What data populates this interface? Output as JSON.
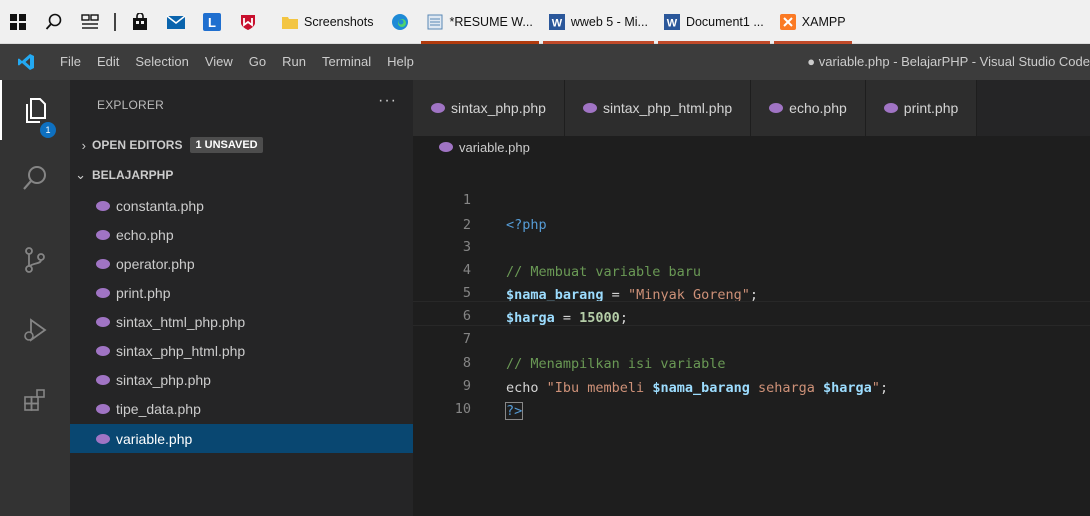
{
  "taskbar": {
    "windows": [
      {
        "label": "Screenshots"
      },
      {
        "label": "*RESUME W..."
      },
      {
        "label": "wweb 5 - Mi..."
      },
      {
        "label": "Document1 ..."
      },
      {
        "label": "XAMPP"
      }
    ]
  },
  "menubar": {
    "items": [
      "File",
      "Edit",
      "Selection",
      "View",
      "Go",
      "Run",
      "Terminal",
      "Help"
    ],
    "window_title": "● variable.php - BelajarPHP - Visual Studio Code"
  },
  "activity": {
    "explorer_badge": "1"
  },
  "sidebar": {
    "header": "EXPLORER",
    "more": "···",
    "open_editors": {
      "label": "OPEN EDITORS",
      "badge": "1 UNSAVED"
    },
    "folder": "BELAJARPHP",
    "files": [
      "constanta.php",
      "echo.php",
      "operator.php",
      "print.php",
      "sintax_html_php.php",
      "sintax_php_html.php",
      "sintax_php.php",
      "tipe_data.php",
      "variable.php"
    ],
    "selected_file": "variable.php"
  },
  "tabs": [
    "sintax_php.php",
    "sintax_php_html.php",
    "echo.php",
    "print.php"
  ],
  "breadcrumb": "variable.php",
  "editor": {
    "line_numbers": [
      "1",
      "2",
      "3",
      "4",
      "5",
      "6",
      "7",
      "8",
      "9",
      "10"
    ],
    "lines": {
      "l1_tag": "<?php",
      "l3_comment": "// Membuat variable baru",
      "l4_var": "$nama_barang",
      "l4_op": " = ",
      "l4_str": "\"Minyak Goreng\"",
      "l4_end": ";",
      "l5_var": "$harga",
      "l5_op": " = ",
      "l5_num": "15000",
      "l5_end": ";",
      "l7_comment": "// Menampilkan isi variable",
      "l8_echo": "echo ",
      "l8_str1": "\"Ibu membeli ",
      "l8_var1": "$nama_barang",
      "l8_str2": " seharga ",
      "l8_var2": "$harga",
      "l8_str3": "\"",
      "l8_end": ";",
      "l9_tag": "?>"
    }
  }
}
